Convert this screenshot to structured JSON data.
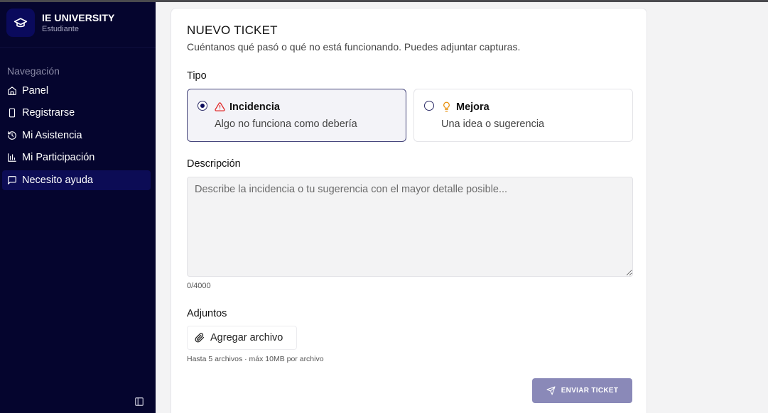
{
  "sidebar": {
    "brand_name": "IE UNIVERSITY",
    "brand_role": "Estudiante",
    "nav_title": "Navegación",
    "items": [
      {
        "label": "Panel",
        "icon": "home-icon"
      },
      {
        "label": "Registrarse",
        "icon": "phone-icon"
      },
      {
        "label": "Mi Asistencia",
        "icon": "history-icon"
      },
      {
        "label": "Mi Participación",
        "icon": "bar-chart-icon"
      },
      {
        "label": "Necesito ayuda",
        "icon": "message-icon",
        "active": true
      }
    ]
  },
  "ticket": {
    "title": "NUEVO TICKET",
    "subtitle": "Cuéntanos qué pasó o qué no está funcionando. Puedes adjuntar capturas.",
    "type_label": "Tipo",
    "types": [
      {
        "title": "Incidencia",
        "description": "Algo no funciona como debería",
        "icon": "warning-triangle-icon",
        "selected": true
      },
      {
        "title": "Mejora",
        "description": "Una idea o sugerencia",
        "icon": "lightbulb-icon",
        "selected": false
      }
    ],
    "description_label": "Descripción",
    "description_value": "",
    "description_placeholder": "Describe la incidencia o tu sugerencia con el mayor detalle posible...",
    "char_counter": "0/4000",
    "attachments_label": "Adjuntos",
    "add_file_label": "Agregar archivo",
    "attachments_hint": "Hasta 5 archivos · máx 10MB por archivo",
    "submit_label": "ENVIAR TICKET"
  },
  "colors": {
    "sidebar_bg": "#05052e",
    "nav_active_bg": "#0c0c55",
    "accent": "#0a0a5c",
    "warning_icon": "#e02424",
    "bulb_icon": "#e8900c",
    "submit_bg": "#8a89b8"
  }
}
